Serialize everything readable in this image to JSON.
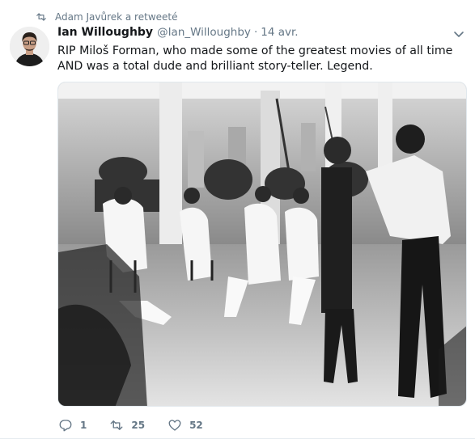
{
  "retweet_context": {
    "icon": "retweet-icon",
    "text": "Adam Javůrek a retweeté"
  },
  "author": {
    "name": "Ian Willoughby",
    "handle": "@Ian_Willoughby",
    "separator": "·",
    "time": "14 avr."
  },
  "tweet": {
    "text": "RIP Miloš Forman, who made some of the greatest movies of all time AND was a total dude and brilliant story-teller. Legend."
  },
  "media": {
    "kind": "black-and-white photograph"
  },
  "actions": {
    "reply_count": "1",
    "retweet_count": "25",
    "like_count": "52"
  },
  "colors": {
    "secondary_text": "#657786",
    "primary_text": "#14171a",
    "border": "#e6ecf0"
  }
}
